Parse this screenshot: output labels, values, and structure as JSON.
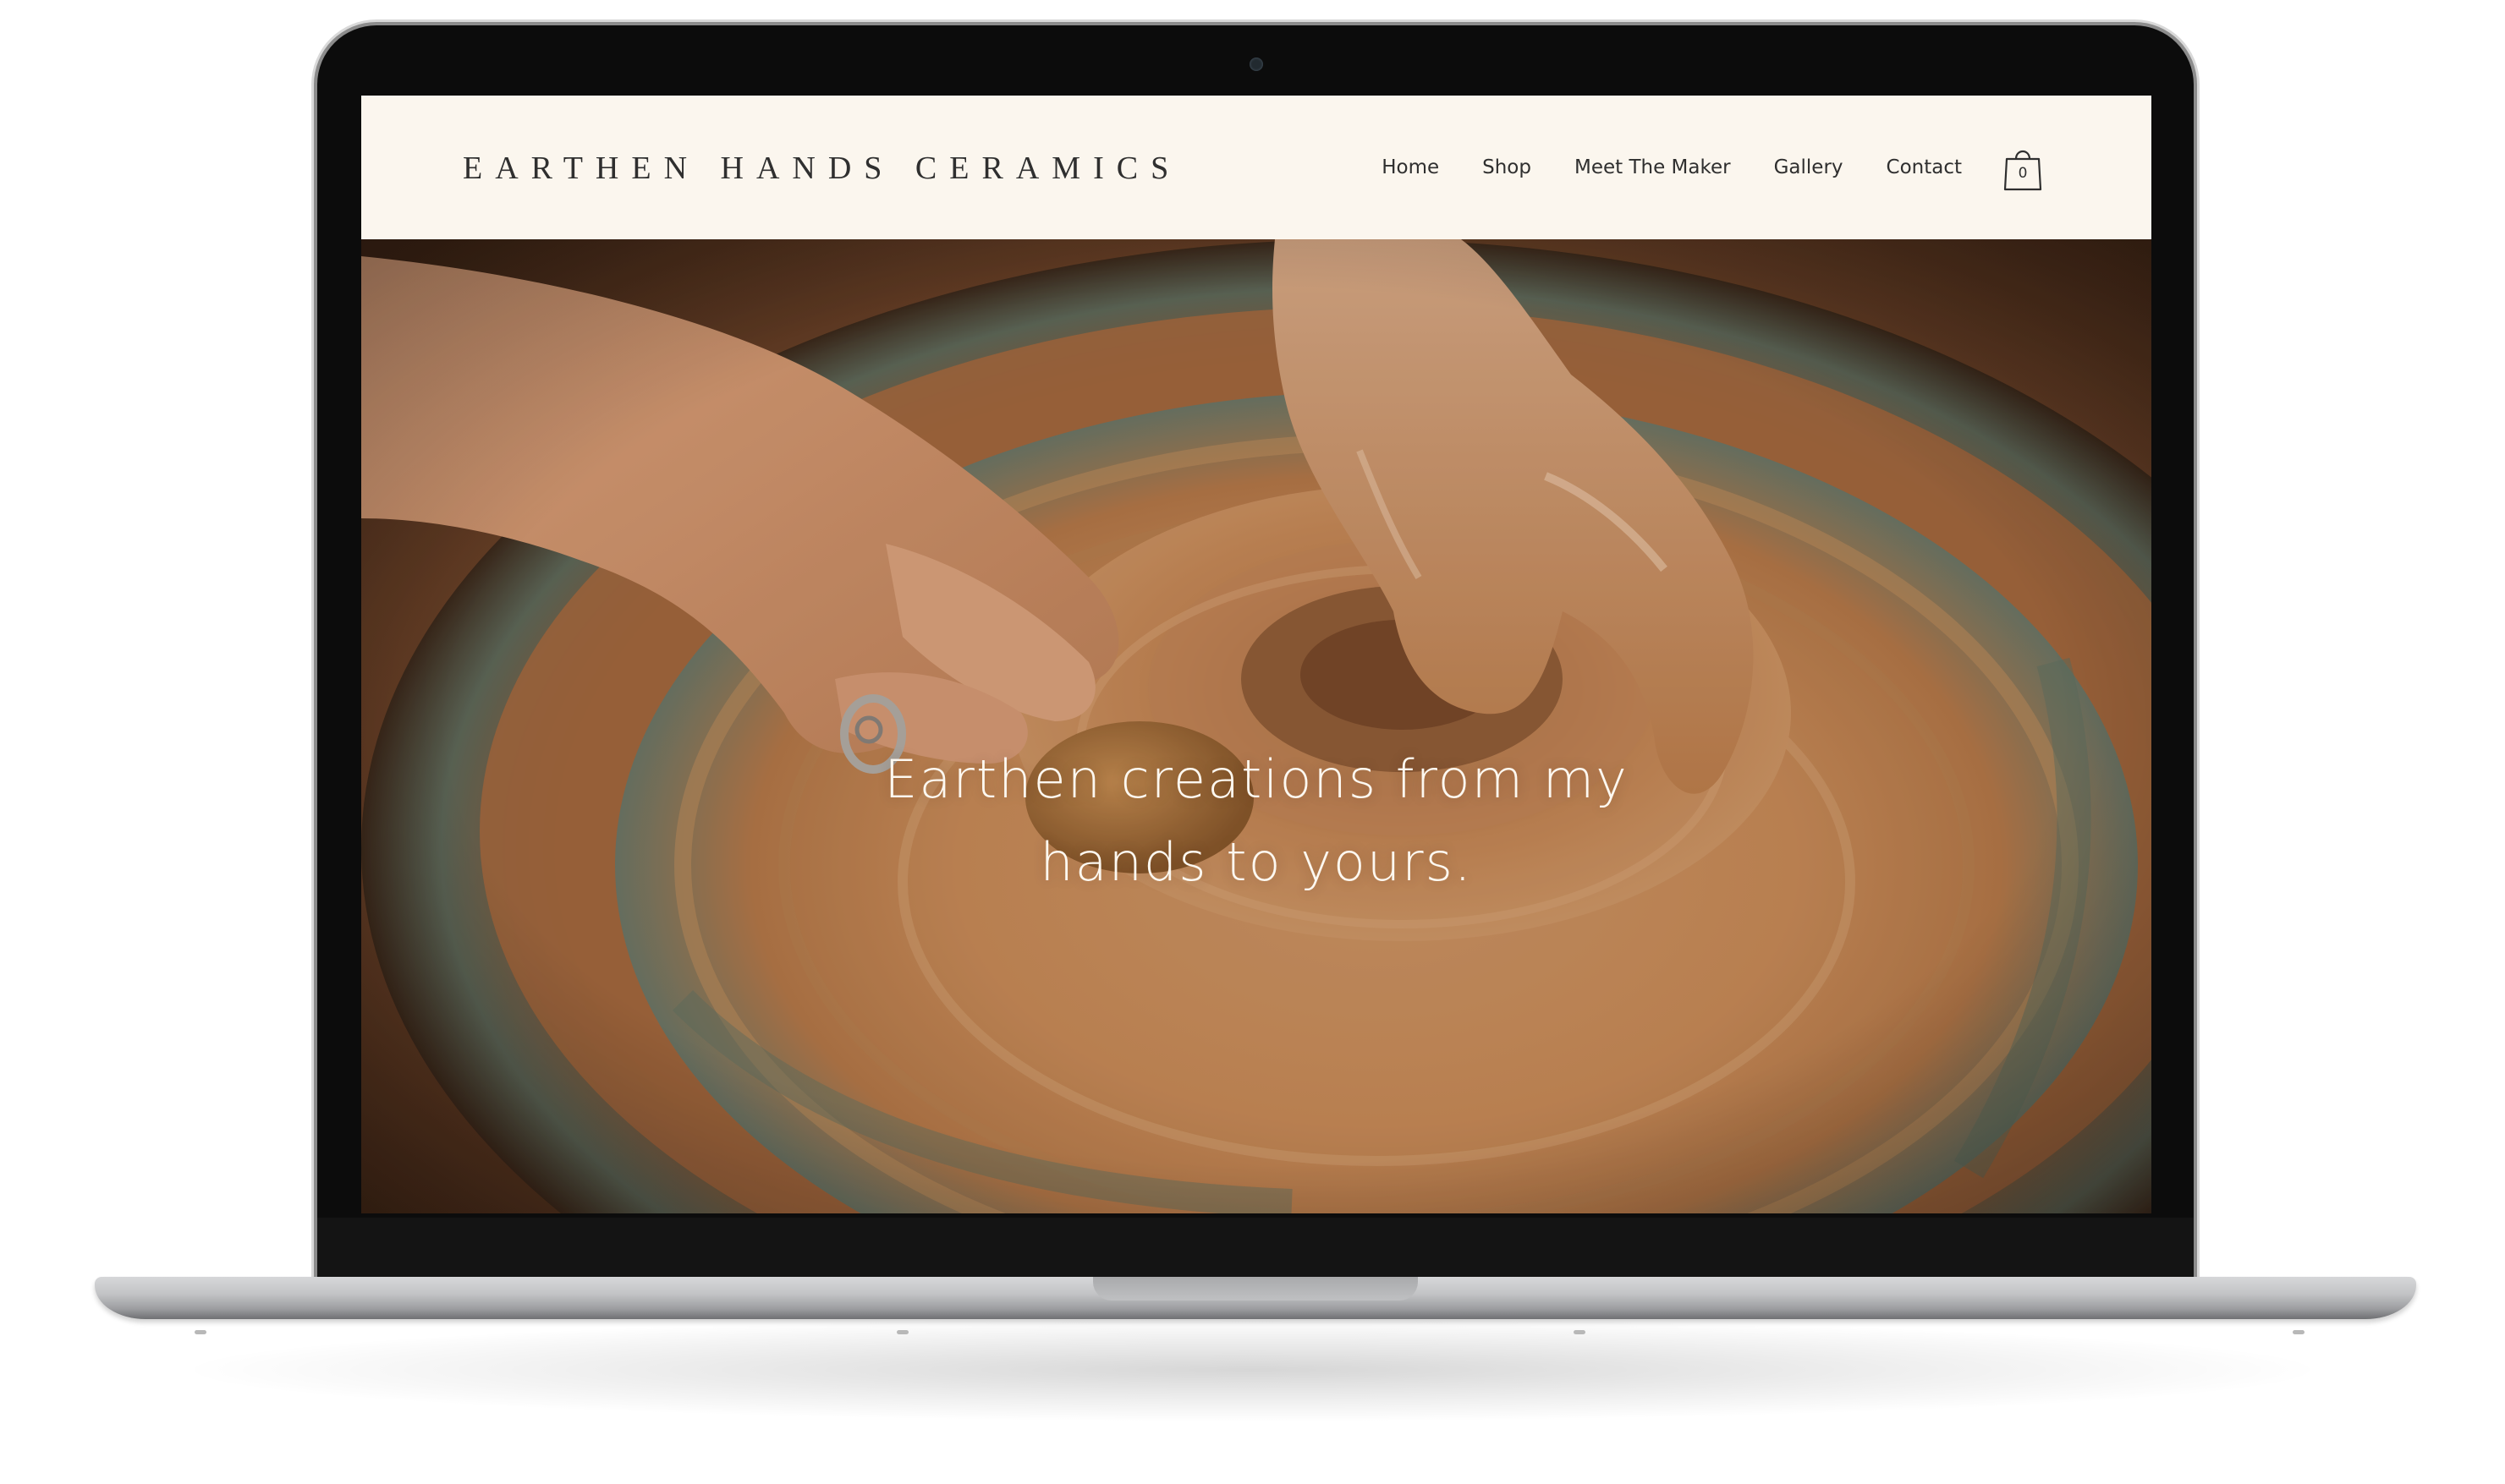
{
  "site": {
    "logo": "Earthen Hands Ceramics",
    "nav": {
      "items": [
        "Home",
        "Shop",
        "Meet The Maker",
        "Gallery",
        "Contact"
      ],
      "cart_count": "0"
    },
    "hero": {
      "headline_line1": "Earthen creations from my",
      "headline_line2": "hands to yours."
    }
  },
  "icons": {
    "cart": "shopping-bag-icon"
  },
  "colors": {
    "header_bg": "#fbf6ee",
    "text_dark": "#2f2f2f",
    "clay": "#c98a55",
    "hero_text": "#fdf8f0"
  }
}
